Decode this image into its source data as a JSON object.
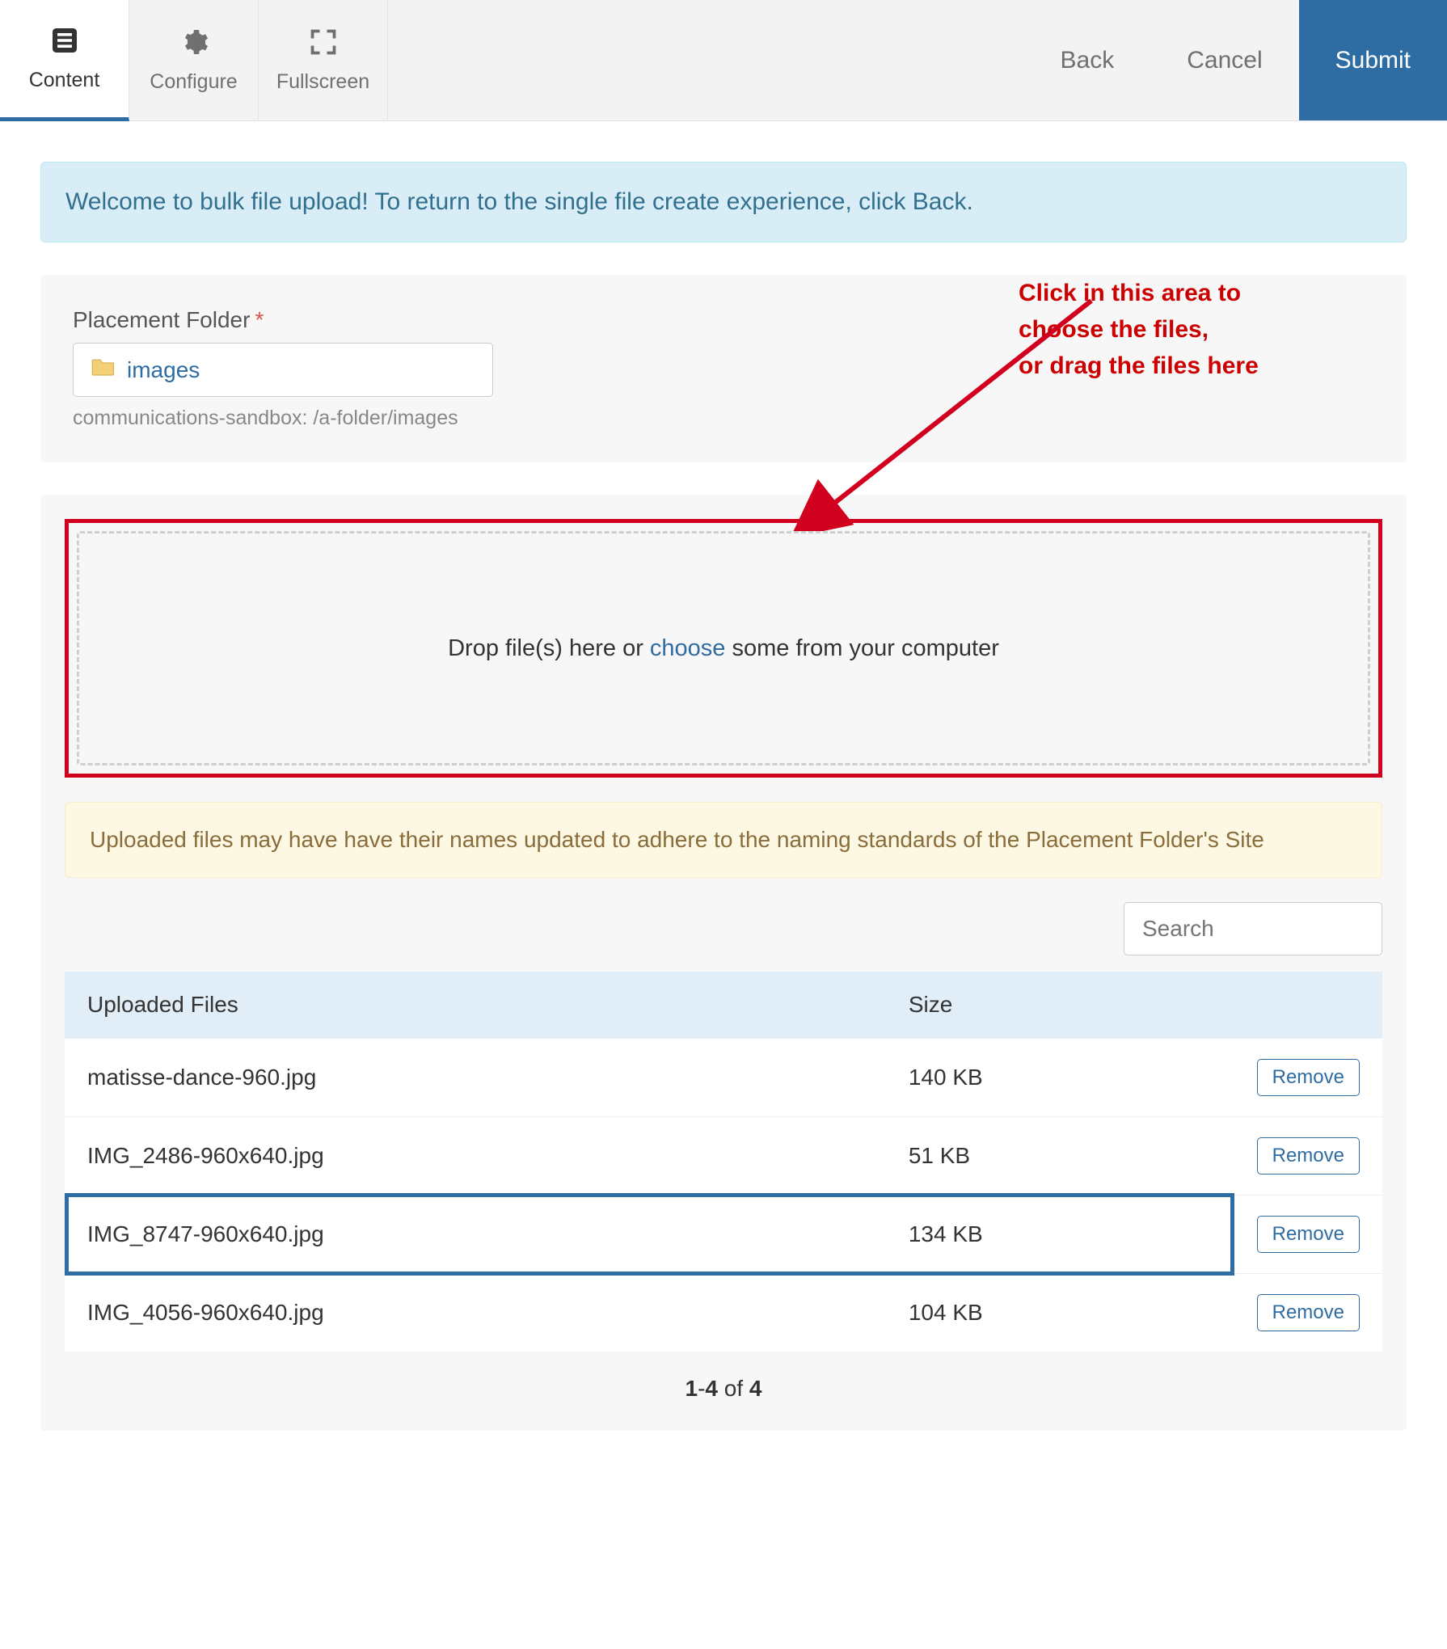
{
  "topbar": {
    "tabs": [
      {
        "label": "Content"
      },
      {
        "label": "Configure"
      },
      {
        "label": "Fullscreen"
      }
    ],
    "back": "Back",
    "cancel": "Cancel",
    "submit": "Submit"
  },
  "welcome": "Welcome to bulk file upload! To return to the single file create experience, click Back.",
  "placement": {
    "label": "Placement Folder",
    "required": "*",
    "folder_name": "images",
    "path": "communications-sandbox: /a-folder/images"
  },
  "annotation": {
    "line1": "Click in this area to",
    "line2": "choose the files,",
    "line3": "or drag the files here"
  },
  "dropzone": {
    "pre": "Drop file(s) here or ",
    "link": "choose",
    "post": " some from your computer"
  },
  "warning": "Uploaded files may have have their names updated to adhere to the naming standards of the Placement Folder's Site",
  "search": {
    "placeholder": "Search"
  },
  "table": {
    "headers": {
      "file": "Uploaded Files",
      "size": "Size"
    },
    "rows": [
      {
        "name": "matisse-dance-960.jpg",
        "size": "140 KB",
        "highlight": false
      },
      {
        "name": "IMG_2486-960x640.jpg",
        "size": "51 KB",
        "highlight": false
      },
      {
        "name": "IMG_8747-960x640.jpg",
        "size": "134 KB",
        "highlight": true
      },
      {
        "name": "IMG_4056-960x640.jpg",
        "size": "104 KB",
        "highlight": false
      }
    ],
    "remove_label": "Remove"
  },
  "pager": {
    "start": "1",
    "end": "4",
    "of": " of ",
    "total": "4",
    "dash": "-"
  }
}
